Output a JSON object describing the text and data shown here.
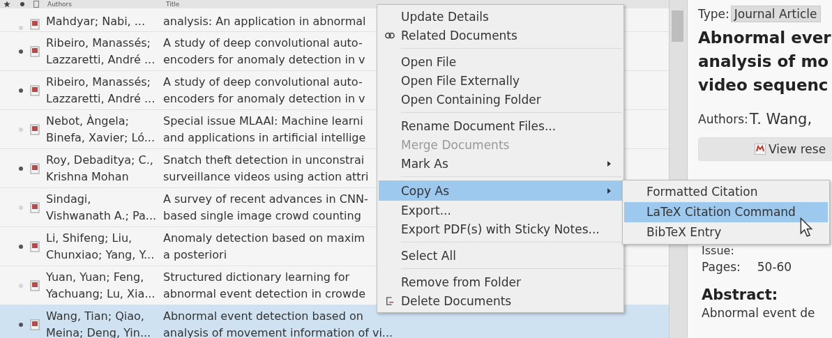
{
  "table": {
    "columns": [
      "Authors",
      "Title"
    ],
    "rows": [
      {
        "authors": [
          "Mahdyar; Nabi, ..."
        ],
        "title": [
          "analysis: An application in abnormal"
        ],
        "unread": false,
        "selected": false
      },
      {
        "authors": [
          "Ribeiro, Manassés;",
          "Lazzaretti, André ..."
        ],
        "title": [
          "A study of deep convolutional auto-",
          "encoders for anomaly detection in v"
        ],
        "unread": true,
        "selected": false
      },
      {
        "authors": [
          "Ribeiro, Manassés;",
          "Lazzaretti, André ..."
        ],
        "title": [
          "A study of deep convolutional auto-",
          "encoders for anomaly detection in v"
        ],
        "unread": true,
        "selected": false
      },
      {
        "authors": [
          "Nebot, Àngela;",
          "Binefa, Xavier; Ló..."
        ],
        "title": [
          "Special issue MLAAI: Machine learni",
          "and applications in artificial intellige"
        ],
        "unread": false,
        "selected": false
      },
      {
        "authors": [
          "Roy, Debaditya; C.,",
          "Krishna Mohan"
        ],
        "title": [
          "Snatch theft detection in unconstrai",
          "surveillance videos using action attri"
        ],
        "unread": true,
        "selected": false
      },
      {
        "authors": [
          "Sindagi,",
          "Vishwanath A.; Pa..."
        ],
        "title": [
          "A survey of recent advances in CNN-",
          "based single image crowd counting"
        ],
        "unread": false,
        "selected": false
      },
      {
        "authors": [
          "Li, Shifeng; Liu,",
          "Chunxiao; Yang, Y..."
        ],
        "title": [
          "Anomaly detection based on maxim",
          "a posteriori"
        ],
        "unread": true,
        "selected": false
      },
      {
        "authors": [
          "Yuan, Yuan; Feng,",
          "Yachuang; Lu, Xia..."
        ],
        "title": [
          "Structured dictionary learning for",
          "abnormal event detection in crowde"
        ],
        "unread": false,
        "selected": false
      },
      {
        "authors": [
          "Wang, Tian; Qiao,",
          "Meina; Deng, Yin..."
        ],
        "title": [
          "Abnormal event detection based on",
          "analysis of movement information of vi..."
        ],
        "unread": true,
        "selected": true
      }
    ]
  },
  "context_menu": {
    "items": [
      {
        "kind": "item",
        "label": "Update Details",
        "disabled": false,
        "selected": false,
        "submenu": false
      },
      {
        "kind": "related",
        "label": "Related Documents",
        "disabled": false,
        "selected": false,
        "submenu": false
      },
      {
        "kind": "separator"
      },
      {
        "kind": "item",
        "label": "Open File",
        "disabled": false,
        "selected": false,
        "submenu": false
      },
      {
        "kind": "item",
        "label": "Open File Externally",
        "disabled": false,
        "selected": false,
        "submenu": false
      },
      {
        "kind": "item",
        "label": "Open Containing Folder",
        "disabled": false,
        "selected": false,
        "submenu": false
      },
      {
        "kind": "separator"
      },
      {
        "kind": "item",
        "label": "Rename Document Files...",
        "disabled": false,
        "selected": false,
        "submenu": false
      },
      {
        "kind": "item",
        "label": "Merge Documents",
        "disabled": true,
        "selected": false,
        "submenu": false
      },
      {
        "kind": "item",
        "label": "Mark As",
        "disabled": false,
        "selected": false,
        "submenu": true
      },
      {
        "kind": "separator"
      },
      {
        "kind": "item",
        "label": "Copy As",
        "disabled": false,
        "selected": true,
        "submenu": true
      },
      {
        "kind": "item",
        "label": "Export...",
        "disabled": false,
        "selected": false,
        "submenu": false
      },
      {
        "kind": "item",
        "label": "Export PDF(s) with Sticky Notes...",
        "disabled": false,
        "selected": false,
        "submenu": false
      },
      {
        "kind": "separator"
      },
      {
        "kind": "item",
        "label": "Select All",
        "disabled": false,
        "selected": false,
        "submenu": false
      },
      {
        "kind": "separator"
      },
      {
        "kind": "item",
        "label": "Remove from Folder",
        "disabled": false,
        "selected": false,
        "submenu": false
      },
      {
        "kind": "delete",
        "label": "Delete Documents",
        "disabled": false,
        "selected": false,
        "submenu": false
      }
    ]
  },
  "submenu": {
    "items": [
      {
        "label": "Formatted Citation",
        "selected": false
      },
      {
        "label": "LaTeX Citation Command",
        "selected": true
      },
      {
        "label": "BibTeX Entry",
        "selected": false
      }
    ]
  },
  "details": {
    "type_label": "Type:",
    "type_value": "Journal Article",
    "title": [
      "Abnormal ever",
      "analysis of mo",
      "video sequenc"
    ],
    "authors_label": "Authors:",
    "authors_value": "T. Wang,",
    "view_button": "View rese",
    "issue_label": "Issue:",
    "pages_label": "Pages:",
    "pages_value": "50-60",
    "abstract_label": "Abstract:",
    "abstract_text": "Abnormal event de"
  }
}
